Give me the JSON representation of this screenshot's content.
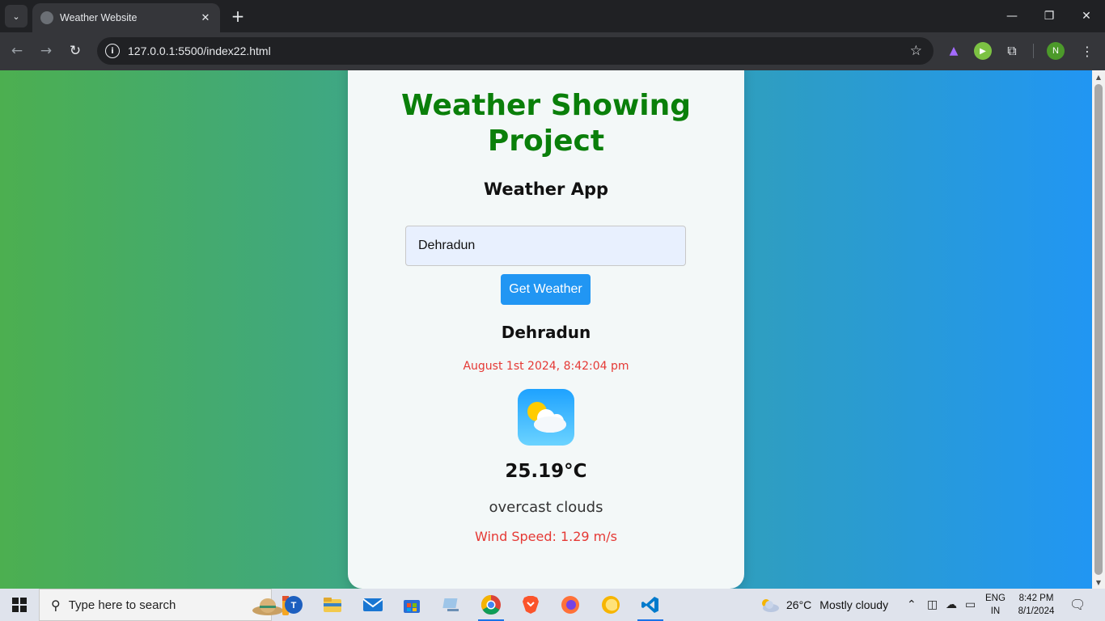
{
  "browser": {
    "tab_title": "Weather Website",
    "tab_close": "✕",
    "new_tab": "+",
    "url": "127.0.0.1:5500/index22.html",
    "profile_initial": "N"
  },
  "page": {
    "project_title": "Weather Showing Project",
    "app_title": "Weather App",
    "city_input_value": "Dehradun",
    "button_label": "Get Weather",
    "city_name": "Dehradun",
    "datetime": "August 1st 2024, 8:42:04 pm",
    "temperature": "25.19°C",
    "description": "overcast clouds",
    "wind": "Wind Speed: 1.29 m/s",
    "colors": {
      "title": "#0a7f0a",
      "accent_red": "#e53935",
      "button": "#2196f3",
      "gradient_start": "#4caf50",
      "gradient_end": "#2196f3"
    }
  },
  "taskbar": {
    "search_placeholder": "Type here to search",
    "weather_temp": "26°C",
    "weather_desc": "Mostly cloudy",
    "lang_line1": "ENG",
    "lang_line2": "IN",
    "time": "8:42 PM",
    "date": "8/1/2024",
    "apps": [
      "task-view",
      "file-explorer",
      "mail",
      "microsoft-store",
      "remote-desktop",
      "chrome",
      "brave",
      "firefox",
      "edge-canary",
      "vscode"
    ]
  }
}
